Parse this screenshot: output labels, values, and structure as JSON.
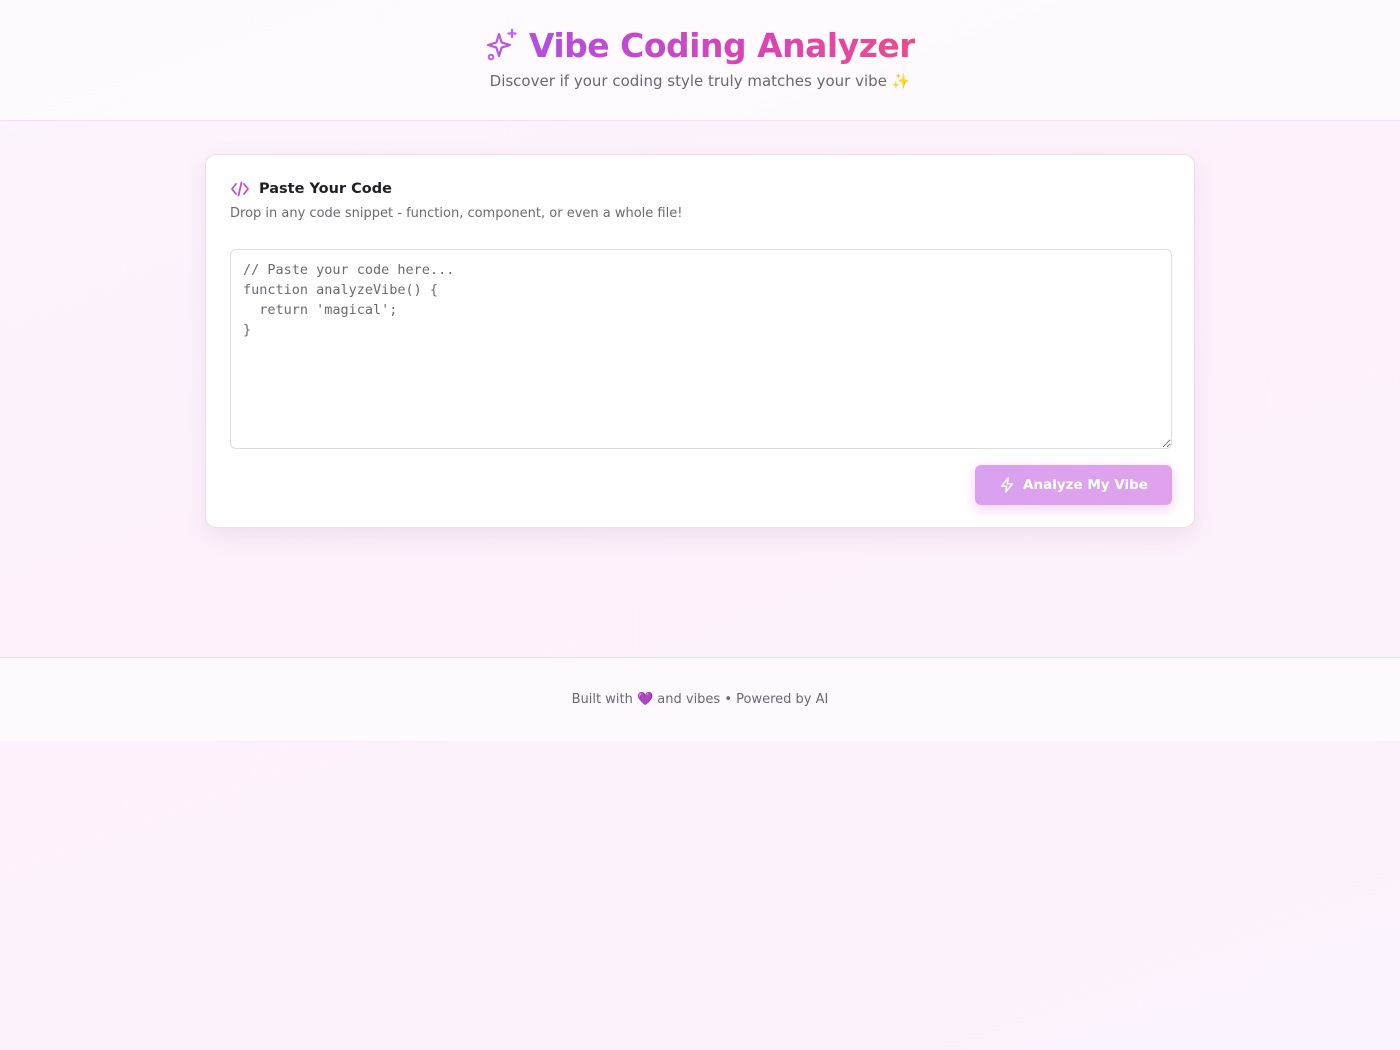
{
  "header": {
    "title": "Vibe Coding Analyzer",
    "subtitle": "Discover if your coding style truly matches your vibe ✨",
    "icon": "sparkles-icon"
  },
  "colors": {
    "accent_purple": "#b24fe0",
    "accent_pink": "#ec4b8a",
    "button_bg": "#d9a1f0"
  },
  "card": {
    "title": "Paste Your Code",
    "description": "Drop in any code snippet - function, component, or even a whole file!",
    "icon": "code-icon",
    "code_placeholder": "// Paste your code here...\nfunction analyzeVibe() {\n  return 'magical';\n}",
    "code_value": "",
    "analyze_button": {
      "label": "Analyze My Vibe",
      "icon": "lightning-bolt-icon"
    }
  },
  "footer": {
    "text": "Built with 💜 and vibes • Powered by AI"
  }
}
